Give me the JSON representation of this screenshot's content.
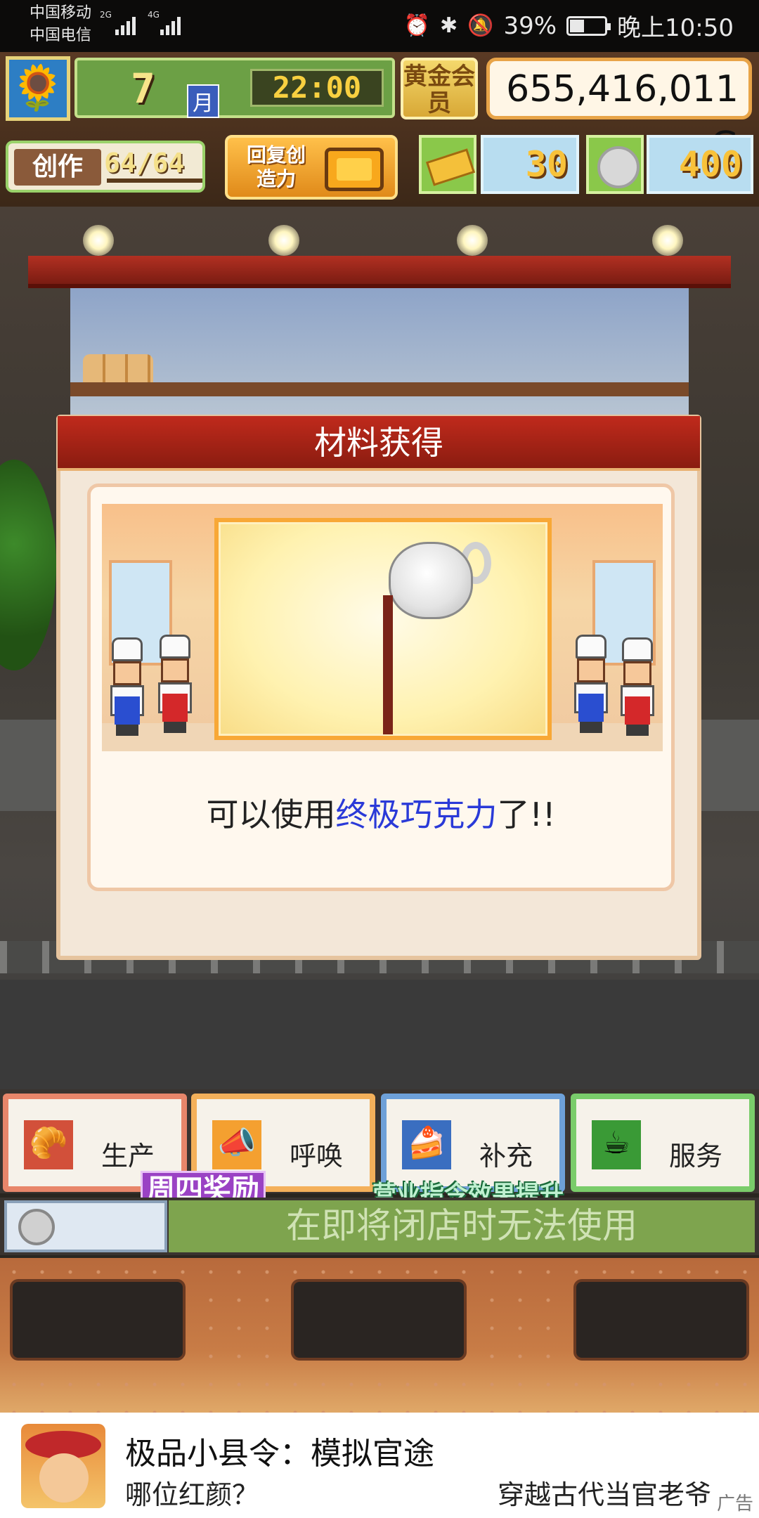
{
  "status_bar": {
    "carrier1": "中国移动",
    "carrier2": "中国电信",
    "signal1": "2G",
    "signal2": "4G",
    "battery": "39%",
    "time": "晚上10:50",
    "icons": [
      "alarm-icon",
      "bluetooth-icon",
      "mute-icon",
      "battery-icon"
    ],
    "battery_level": 0.39
  },
  "hud": {
    "month": "7",
    "month_unit": "月",
    "time": "22:00",
    "gold_member": "黄金会员",
    "money": "655,416,011 G",
    "create_label": "创作",
    "create_value": "64/64",
    "recover_label": "回复创造力",
    "tickets": "30",
    "medals": "400"
  },
  "modal": {
    "title": "材料获得",
    "text_prefix": "可以使用",
    "text_highlight": "终极巧克力",
    "text_suffix": "了!!",
    "highlight_color": "#2a3ad8"
  },
  "commands": {
    "produce": "生产",
    "call": "呼唤",
    "restock": "补充",
    "service": "服务"
  },
  "banners": {
    "thursday_reward": "周四奖励",
    "boost": "营业指令效果提升",
    "notice": "在即将闭店时无法使用"
  },
  "ad": {
    "title": "极品小县令：模拟官途",
    "subtitle": "哪位红颜？",
    "tagline": "穿越古代当官老爷",
    "tag": "广告"
  },
  "colors": {
    "header_red": "#c02a1c",
    "money_border": "#e8a448",
    "notice_green": "#7ea44e"
  }
}
